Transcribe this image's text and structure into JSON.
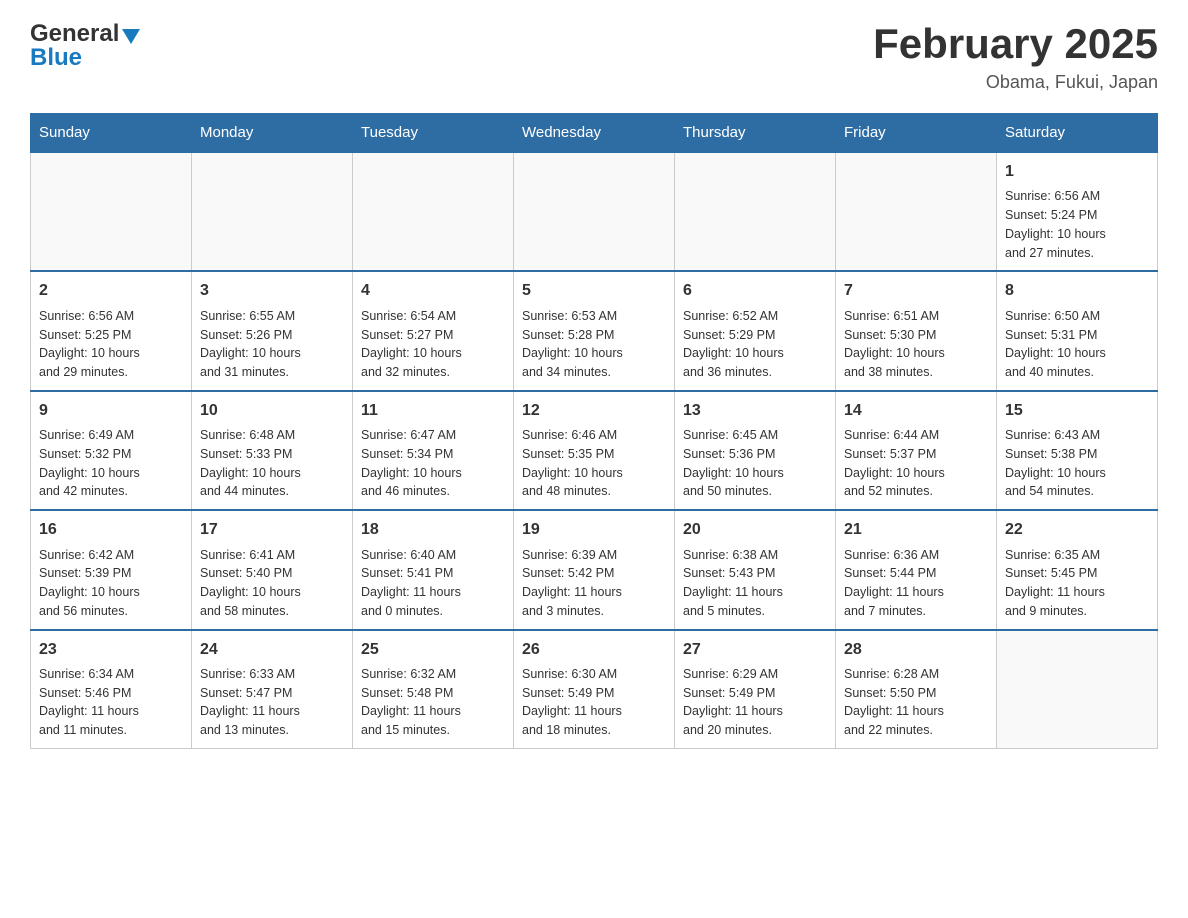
{
  "header": {
    "logo_general": "General",
    "logo_blue": "Blue",
    "month_title": "February 2025",
    "location": "Obama, Fukui, Japan"
  },
  "days_of_week": [
    "Sunday",
    "Monday",
    "Tuesday",
    "Wednesday",
    "Thursday",
    "Friday",
    "Saturday"
  ],
  "weeks": [
    {
      "days": [
        {
          "number": "",
          "info": ""
        },
        {
          "number": "",
          "info": ""
        },
        {
          "number": "",
          "info": ""
        },
        {
          "number": "",
          "info": ""
        },
        {
          "number": "",
          "info": ""
        },
        {
          "number": "",
          "info": ""
        },
        {
          "number": "1",
          "info": "Sunrise: 6:56 AM\nSunset: 5:24 PM\nDaylight: 10 hours\nand 27 minutes."
        }
      ]
    },
    {
      "days": [
        {
          "number": "2",
          "info": "Sunrise: 6:56 AM\nSunset: 5:25 PM\nDaylight: 10 hours\nand 29 minutes."
        },
        {
          "number": "3",
          "info": "Sunrise: 6:55 AM\nSunset: 5:26 PM\nDaylight: 10 hours\nand 31 minutes."
        },
        {
          "number": "4",
          "info": "Sunrise: 6:54 AM\nSunset: 5:27 PM\nDaylight: 10 hours\nand 32 minutes."
        },
        {
          "number": "5",
          "info": "Sunrise: 6:53 AM\nSunset: 5:28 PM\nDaylight: 10 hours\nand 34 minutes."
        },
        {
          "number": "6",
          "info": "Sunrise: 6:52 AM\nSunset: 5:29 PM\nDaylight: 10 hours\nand 36 minutes."
        },
        {
          "number": "7",
          "info": "Sunrise: 6:51 AM\nSunset: 5:30 PM\nDaylight: 10 hours\nand 38 minutes."
        },
        {
          "number": "8",
          "info": "Sunrise: 6:50 AM\nSunset: 5:31 PM\nDaylight: 10 hours\nand 40 minutes."
        }
      ]
    },
    {
      "days": [
        {
          "number": "9",
          "info": "Sunrise: 6:49 AM\nSunset: 5:32 PM\nDaylight: 10 hours\nand 42 minutes."
        },
        {
          "number": "10",
          "info": "Sunrise: 6:48 AM\nSunset: 5:33 PM\nDaylight: 10 hours\nand 44 minutes."
        },
        {
          "number": "11",
          "info": "Sunrise: 6:47 AM\nSunset: 5:34 PM\nDaylight: 10 hours\nand 46 minutes."
        },
        {
          "number": "12",
          "info": "Sunrise: 6:46 AM\nSunset: 5:35 PM\nDaylight: 10 hours\nand 48 minutes."
        },
        {
          "number": "13",
          "info": "Sunrise: 6:45 AM\nSunset: 5:36 PM\nDaylight: 10 hours\nand 50 minutes."
        },
        {
          "number": "14",
          "info": "Sunrise: 6:44 AM\nSunset: 5:37 PM\nDaylight: 10 hours\nand 52 minutes."
        },
        {
          "number": "15",
          "info": "Sunrise: 6:43 AM\nSunset: 5:38 PM\nDaylight: 10 hours\nand 54 minutes."
        }
      ]
    },
    {
      "days": [
        {
          "number": "16",
          "info": "Sunrise: 6:42 AM\nSunset: 5:39 PM\nDaylight: 10 hours\nand 56 minutes."
        },
        {
          "number": "17",
          "info": "Sunrise: 6:41 AM\nSunset: 5:40 PM\nDaylight: 10 hours\nand 58 minutes."
        },
        {
          "number": "18",
          "info": "Sunrise: 6:40 AM\nSunset: 5:41 PM\nDaylight: 11 hours\nand 0 minutes."
        },
        {
          "number": "19",
          "info": "Sunrise: 6:39 AM\nSunset: 5:42 PM\nDaylight: 11 hours\nand 3 minutes."
        },
        {
          "number": "20",
          "info": "Sunrise: 6:38 AM\nSunset: 5:43 PM\nDaylight: 11 hours\nand 5 minutes."
        },
        {
          "number": "21",
          "info": "Sunrise: 6:36 AM\nSunset: 5:44 PM\nDaylight: 11 hours\nand 7 minutes."
        },
        {
          "number": "22",
          "info": "Sunrise: 6:35 AM\nSunset: 5:45 PM\nDaylight: 11 hours\nand 9 minutes."
        }
      ]
    },
    {
      "days": [
        {
          "number": "23",
          "info": "Sunrise: 6:34 AM\nSunset: 5:46 PM\nDaylight: 11 hours\nand 11 minutes."
        },
        {
          "number": "24",
          "info": "Sunrise: 6:33 AM\nSunset: 5:47 PM\nDaylight: 11 hours\nand 13 minutes."
        },
        {
          "number": "25",
          "info": "Sunrise: 6:32 AM\nSunset: 5:48 PM\nDaylight: 11 hours\nand 15 minutes."
        },
        {
          "number": "26",
          "info": "Sunrise: 6:30 AM\nSunset: 5:49 PM\nDaylight: 11 hours\nand 18 minutes."
        },
        {
          "number": "27",
          "info": "Sunrise: 6:29 AM\nSunset: 5:49 PM\nDaylight: 11 hours\nand 20 minutes."
        },
        {
          "number": "28",
          "info": "Sunrise: 6:28 AM\nSunset: 5:50 PM\nDaylight: 11 hours\nand 22 minutes."
        },
        {
          "number": "",
          "info": ""
        }
      ]
    }
  ]
}
